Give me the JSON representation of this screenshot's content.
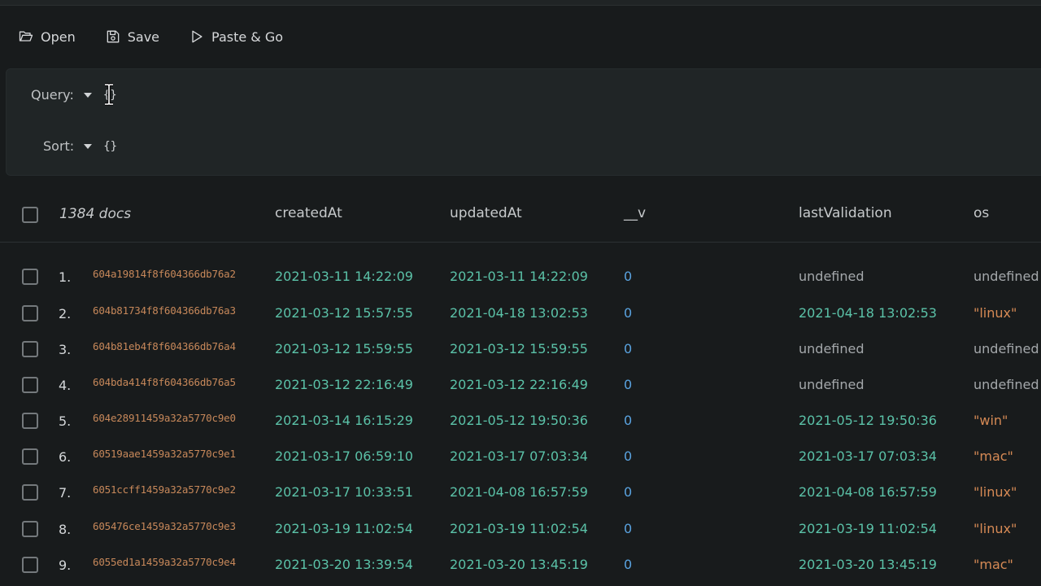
{
  "toolbar": {
    "open_label": "Open",
    "save_label": "Save",
    "paste_go_label": "Paste & Go"
  },
  "query": {
    "query_label": "Query:",
    "query_value": "{}",
    "sort_label": "Sort:",
    "sort_value": "{}"
  },
  "table": {
    "count_label": "1384 docs",
    "columns": [
      "createdAt",
      "updatedAt",
      "__v",
      "lastValidation",
      "os"
    ],
    "rows": [
      {
        "num": "1.",
        "id": "604a19814f8f604366db76a2",
        "createdAt": "2021-03-11 14:22:09",
        "updatedAt": "2021-03-11 14:22:09",
        "v": "0",
        "lastValidation": "undefined",
        "os": "undefined"
      },
      {
        "num": "2.",
        "id": "604b81734f8f604366db76a3",
        "createdAt": "2021-03-12 15:57:55",
        "updatedAt": "2021-04-18 13:02:53",
        "v": "0",
        "lastValidation": "2021-04-18 13:02:53",
        "os": "\"linux\""
      },
      {
        "num": "3.",
        "id": "604b81eb4f8f604366db76a4",
        "createdAt": "2021-03-12 15:59:55",
        "updatedAt": "2021-03-12 15:59:55",
        "v": "0",
        "lastValidation": "undefined",
        "os": "undefined"
      },
      {
        "num": "4.",
        "id": "604bda414f8f604366db76a5",
        "createdAt": "2021-03-12 22:16:49",
        "updatedAt": "2021-03-12 22:16:49",
        "v": "0",
        "lastValidation": "undefined",
        "os": "undefined"
      },
      {
        "num": "5.",
        "id": "604e28911459a32a5770c9e0",
        "createdAt": "2021-03-14 16:15:29",
        "updatedAt": "2021-05-12 19:50:36",
        "v": "0",
        "lastValidation": "2021-05-12 19:50:36",
        "os": "\"win\""
      },
      {
        "num": "6.",
        "id": "60519aae1459a32a5770c9e1",
        "createdAt": "2021-03-17 06:59:10",
        "updatedAt": "2021-03-17 07:03:34",
        "v": "0",
        "lastValidation": "2021-03-17 07:03:34",
        "os": "\"mac\""
      },
      {
        "num": "7.",
        "id": "6051ccff1459a32a5770c9e2",
        "createdAt": "2021-03-17 10:33:51",
        "updatedAt": "2021-04-08 16:57:59",
        "v": "0",
        "lastValidation": "2021-04-08 16:57:59",
        "os": "\"linux\""
      },
      {
        "num": "8.",
        "id": "605476ce1459a32a5770c9e3",
        "createdAt": "2021-03-19 11:02:54",
        "updatedAt": "2021-03-19 11:02:54",
        "v": "0",
        "lastValidation": "2021-03-19 11:02:54",
        "os": "\"linux\""
      },
      {
        "num": "9.",
        "id": "6055ed1a1459a32a5770c9e4",
        "createdAt": "2021-03-20 13:39:54",
        "updatedAt": "2021-03-20 13:45:19",
        "v": "0",
        "lastValidation": "2021-03-20 13:45:19",
        "os": "\"mac\""
      }
    ]
  },
  "colors": {
    "background": "#181b1c",
    "panel": "#202526",
    "date_green": "#5bc2a8",
    "number_blue": "#5aa3e0",
    "string_orange": "#d68a55",
    "objectid_orange": "#c7885a"
  },
  "icons": [
    "folder-open-icon",
    "save-icon",
    "play-icon",
    "caret-down-icon",
    "text-cursor-icon"
  ]
}
